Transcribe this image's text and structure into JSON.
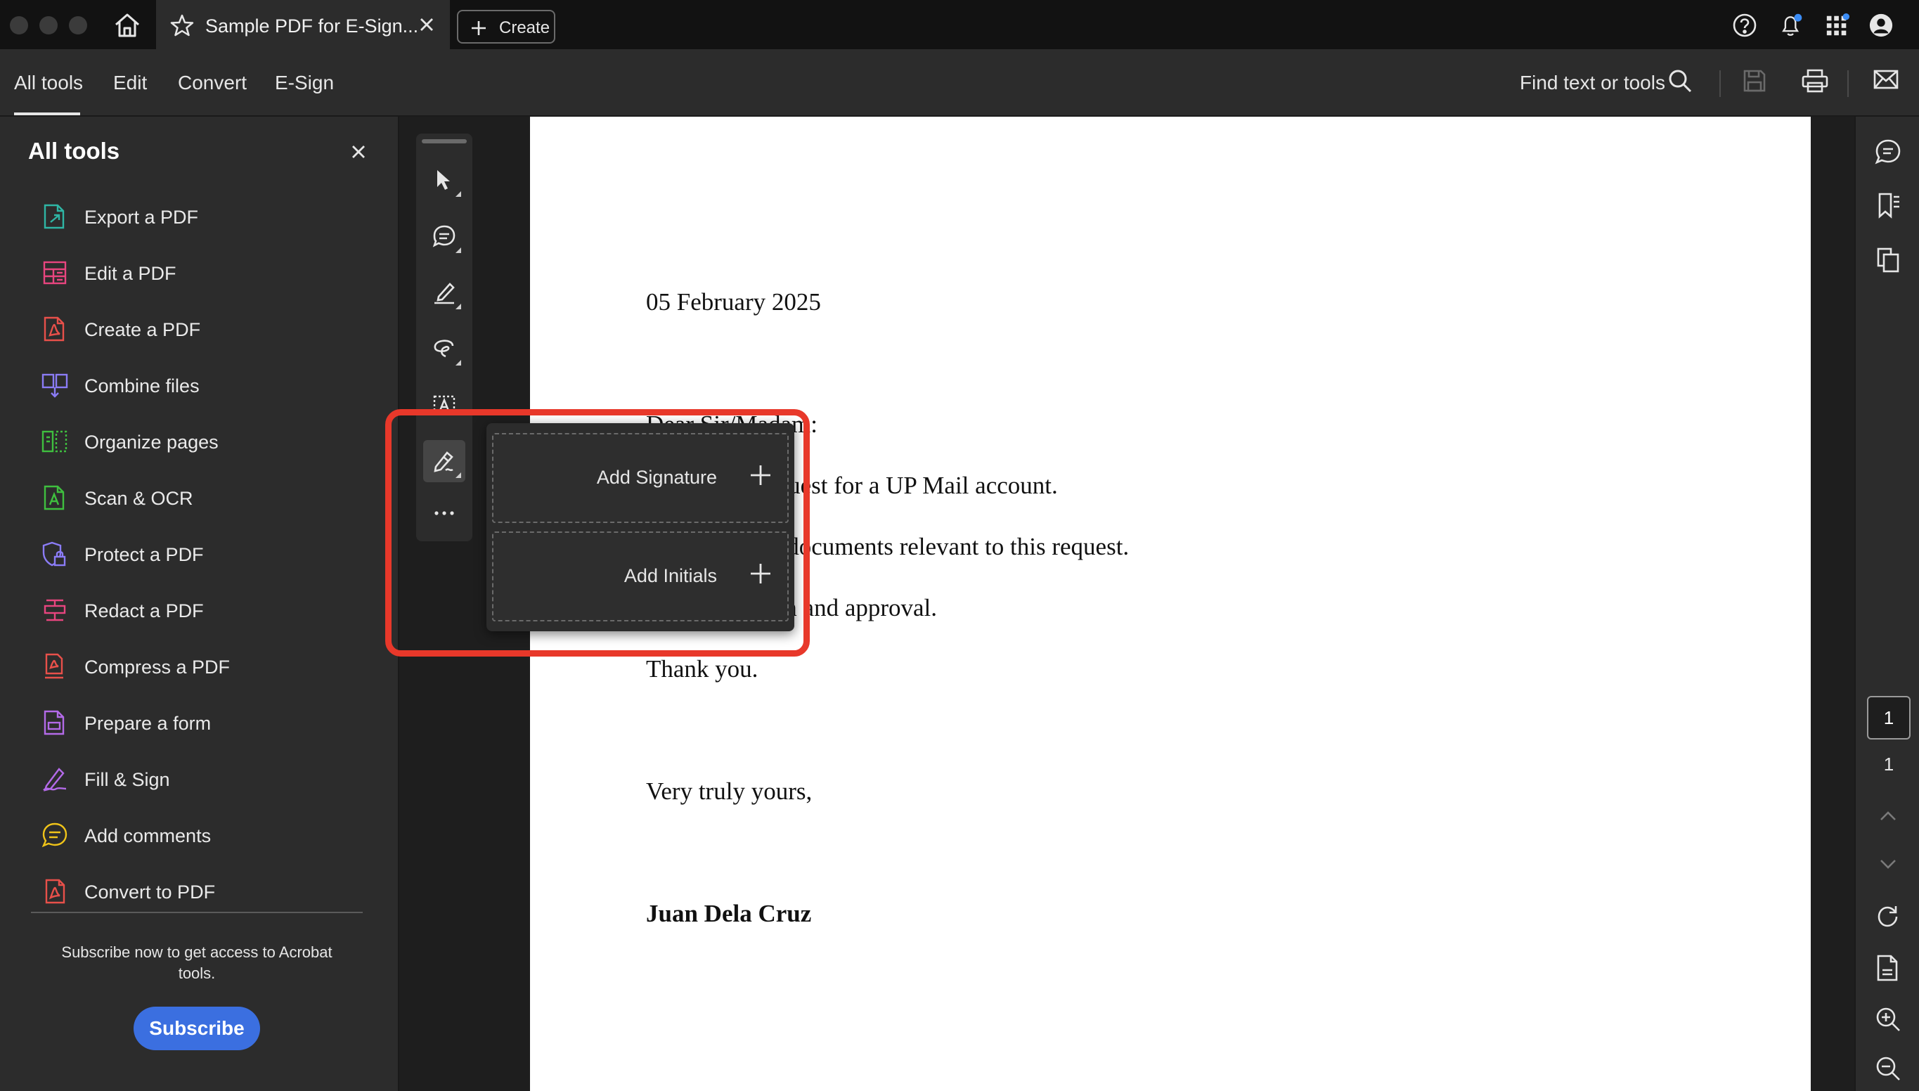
{
  "titlebar": {
    "tab_title": "Sample PDF for E-Sign...",
    "create_label": "Create",
    "icons": [
      "home-icon",
      "star-icon",
      "close-icon",
      "help-icon",
      "notifications-icon",
      "apps-icon",
      "account-icon"
    ]
  },
  "menubar": {
    "tabs": [
      {
        "label": "All tools"
      },
      {
        "label": "Edit"
      },
      {
        "label": "Convert"
      },
      {
        "label": "E-Sign"
      }
    ],
    "active_tab": "All tools",
    "find_label": "Find text or tools",
    "icons": [
      "search-icon",
      "save-icon",
      "print-icon",
      "mail-icon"
    ]
  },
  "left_panel": {
    "title": "All tools",
    "tools": [
      {
        "label": "Export a PDF",
        "icon": "export-pdf-icon",
        "color": "#2fb6a5"
      },
      {
        "label": "Edit a PDF",
        "icon": "edit-pdf-icon",
        "color": "#e8457f"
      },
      {
        "label": "Create a PDF",
        "icon": "create-pdf-icon",
        "color": "#e8504a"
      },
      {
        "label": "Combine files",
        "icon": "combine-files-icon",
        "color": "#8b7cf6"
      },
      {
        "label": "Organize pages",
        "icon": "organize-pages-icon",
        "color": "#3fbf3f"
      },
      {
        "label": "Scan & OCR",
        "icon": "scan-ocr-icon",
        "color": "#3fbf3f"
      },
      {
        "label": "Protect a PDF",
        "icon": "protect-pdf-icon",
        "color": "#8b7cf6"
      },
      {
        "label": "Redact a PDF",
        "icon": "redact-pdf-icon",
        "color": "#e8457f"
      },
      {
        "label": "Compress a PDF",
        "icon": "compress-pdf-icon",
        "color": "#e8504a"
      },
      {
        "label": "Prepare a form",
        "icon": "prepare-form-icon",
        "color": "#b36ae8"
      },
      {
        "label": "Fill & Sign",
        "icon": "fill-sign-icon",
        "color": "#b36ae8"
      },
      {
        "label": "Add comments",
        "icon": "add-comments-icon",
        "color": "#f0c419"
      },
      {
        "label": "Convert to PDF",
        "icon": "convert-to-pdf-icon",
        "color": "#e8504a"
      }
    ],
    "subscribe_text": "Subscribe now to get access to Acrobat tools.",
    "subscribe_label": "Subscribe"
  },
  "toolbar": {
    "tools": [
      "select-icon",
      "comment-icon",
      "highlight-icon",
      "draw-icon",
      "text-box-icon",
      "sign-icon",
      "more-icon"
    ],
    "active_tool": "sign-icon"
  },
  "sign_popup": {
    "items": [
      {
        "label": "Add Signature"
      },
      {
        "label": "Add Initials"
      }
    ],
    "highlight_color": "#e8382a"
  },
  "document": {
    "date": "05 February 2025",
    "salutation": "Dear Sir/Madam:",
    "line1": "...ce to our request for a UP Mail account.",
    "line2": "...with are the documents relevant to this request.",
    "line3": "...consideration and approval.",
    "thanks": "Thank you.",
    "closing": "Very truly yours,",
    "signatory": "Juan Dela Cruz"
  },
  "right_rail": {
    "current_page": "1",
    "total_pages": "1",
    "icons": [
      "comments-panel-icon",
      "bookmarks-icon",
      "pages-icon",
      "chevron-up-icon",
      "chevron-down-icon",
      "rotate-icon",
      "fit-page-icon",
      "zoom-in-icon",
      "zoom-out-icon"
    ]
  },
  "colors": {
    "accent": "#3b6fe0",
    "notification_dot": "#3b8cf5"
  }
}
